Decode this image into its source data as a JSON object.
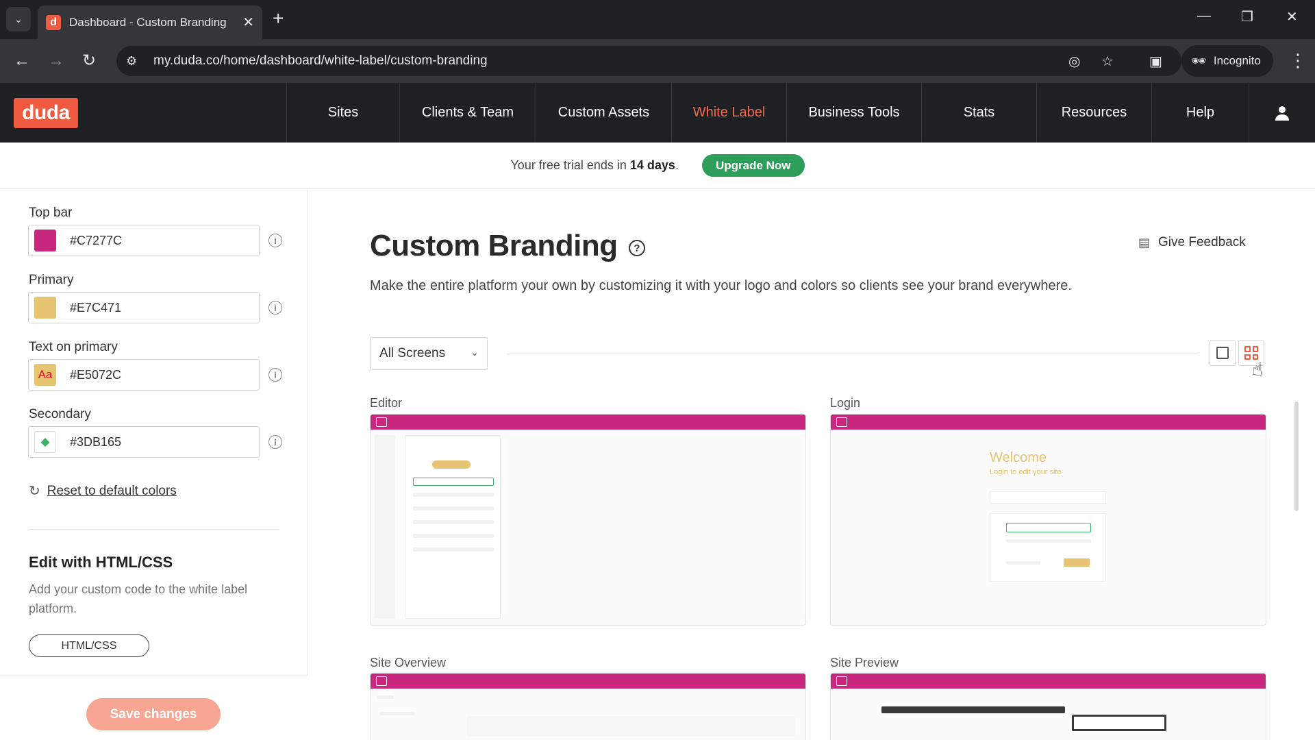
{
  "browser": {
    "tab_title": "Dashboard - Custom Branding",
    "tab_favicon_letter": "d",
    "url": "my.duda.co/home/dashboard/white-label/custom-branding",
    "incognito_label": "Incognito"
  },
  "header": {
    "logo_text": "duda",
    "nav": [
      {
        "label": "Sites"
      },
      {
        "label": "Clients & Team"
      },
      {
        "label": "Custom Assets"
      },
      {
        "label": "White Label",
        "active": true
      },
      {
        "label": "Business Tools"
      },
      {
        "label": "Stats"
      },
      {
        "label": "Resources"
      },
      {
        "label": "Help"
      }
    ]
  },
  "trial": {
    "text_before": "Your free trial ends in ",
    "days": "14 days",
    "text_after": ".",
    "upgrade_label": "Upgrade Now"
  },
  "left_panel": {
    "fields": [
      {
        "label": "Top bar",
        "value": "#C7277C",
        "swatch": "#C7277C"
      },
      {
        "label": "Primary",
        "value": "#E7C471",
        "swatch": "#E7C471"
      },
      {
        "label": "Text on primary",
        "value": "#E5072C",
        "swatch": "#E7C471",
        "swatch_text": "Aa",
        "swatch_text_color": "#E5072C"
      },
      {
        "label": "Secondary",
        "value": "#3DB165",
        "swatch": "#ffffff",
        "swatch_text": "◆",
        "swatch_text_color": "#3DB165"
      }
    ],
    "reset_label": "Reset to default colors",
    "edit_title": "Edit with HTML/CSS",
    "edit_desc": "Add your custom code to the white label platform.",
    "html_button": "HTML/CSS",
    "save_label": "Save changes"
  },
  "main": {
    "title": "Custom Branding",
    "feedback_label": "Give Feedback",
    "description": "Make the entire platform your own by customizing it with your logo and colors so clients see your brand everywhere.",
    "screen_filter": "All Screens",
    "cards": [
      {
        "label": "Editor"
      },
      {
        "label": "Login"
      },
      {
        "label": "Site Overview"
      },
      {
        "label": "Site Preview"
      }
    ],
    "login_preview": {
      "welcome": "Welcome",
      "subtitle": "Login to edit your site"
    }
  },
  "colors": {
    "top_bar": "#C7277C",
    "primary": "#E7C471",
    "secondary": "#3DB165",
    "duda_brand": "#F05A40",
    "upgrade_green": "#2E9E5B"
  }
}
